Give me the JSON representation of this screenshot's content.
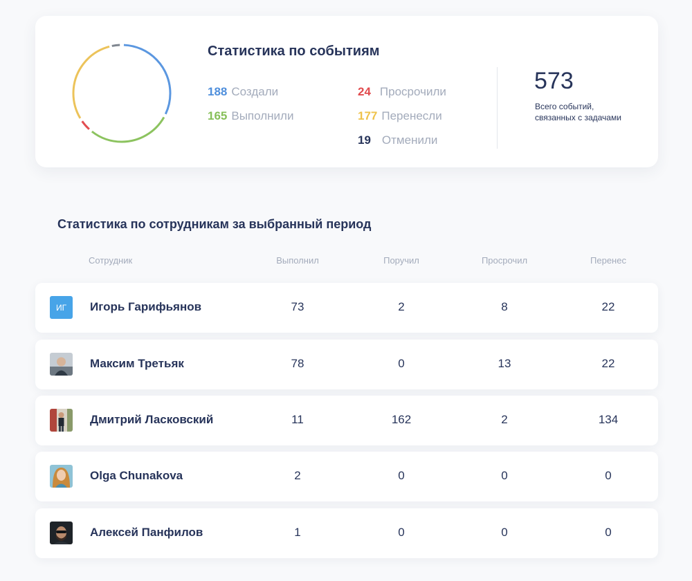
{
  "events": {
    "title": "Статистика по событиям",
    "stats": {
      "created": {
        "value": "188",
        "label": "Создали",
        "color": "#4f8fdc"
      },
      "completed": {
        "value": "165",
        "label": "Выполнили",
        "color": "#86bf58"
      },
      "overdue": {
        "value": "24",
        "label": "Просрочили",
        "color": "#e14b4e"
      },
      "moved": {
        "value": "177",
        "label": "Перенесли",
        "color": "#efc24a"
      },
      "cancelled": {
        "value": "19",
        "label": "Отменили",
        "color": "#27345a"
      }
    },
    "total": {
      "value": "573",
      "caption_line1": "Всего событий,",
      "caption_line2": "связанных с задачами"
    },
    "donut_colors": {
      "created": "#5b97e0",
      "completed": "#8cc35f",
      "overdue": "#e24d50",
      "moved": "#ecc35a",
      "cancelled": "#7f8690"
    }
  },
  "employees": {
    "title": "Статистика по сотрудникам за выбранный период",
    "columns": [
      "Сотрудник",
      "Выполнил",
      "Поручил",
      "Просрочил",
      "Перенес"
    ],
    "rows": [
      {
        "avatar": "ИГ",
        "avatar_type": "initials",
        "name": "Игорь Гарифьянов",
        "values": [
          "73",
          "2",
          "8",
          "22"
        ]
      },
      {
        "avatar": "",
        "avatar_type": "photo",
        "name": "Максим Третьяк",
        "values": [
          "78",
          "0",
          "13",
          "22"
        ]
      },
      {
        "avatar": "",
        "avatar_type": "photo",
        "name": "Дмитрий Ласковский",
        "values": [
          "11",
          "162",
          "2",
          "134"
        ]
      },
      {
        "avatar": "",
        "avatar_type": "photo",
        "name": "Olga Chunakova",
        "values": [
          "2",
          "0",
          "0",
          "0"
        ]
      },
      {
        "avatar": "",
        "avatar_type": "photo",
        "name": "Алексей Панфилов",
        "values": [
          "1",
          "0",
          "0",
          "0"
        ]
      }
    ]
  }
}
